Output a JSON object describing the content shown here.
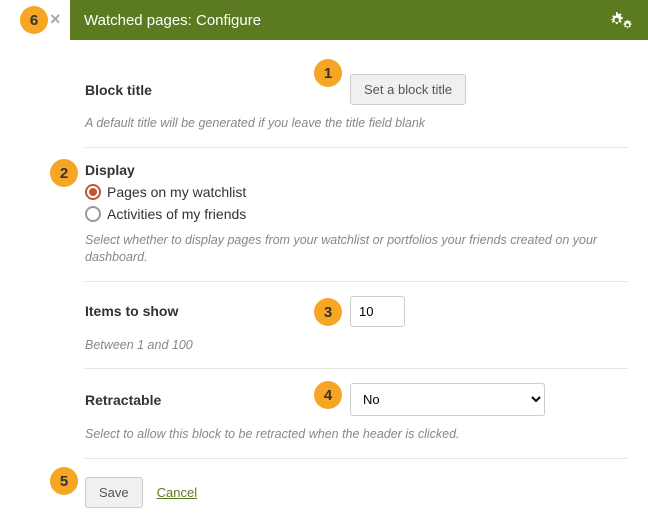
{
  "header": {
    "title": "Watched pages: Configure"
  },
  "blockTitle": {
    "label": "Block title",
    "button": "Set a block title",
    "help": "A default title will be generated if you leave the title field blank"
  },
  "display": {
    "label": "Display",
    "options": [
      {
        "label": "Pages on my watchlist",
        "checked": true
      },
      {
        "label": "Activities of my friends",
        "checked": false
      }
    ],
    "help": "Select whether to display pages from your watchlist or portfolios your friends created on your dashboard."
  },
  "itemsToShow": {
    "label": "Items to show",
    "value": "10",
    "help": "Between 1 and 100"
  },
  "retractable": {
    "label": "Retractable",
    "value": "No",
    "help": "Select to allow this block to be retracted when the header is clicked."
  },
  "actions": {
    "save": "Save",
    "cancel": "Cancel"
  },
  "badges": {
    "b1": "1",
    "b2": "2",
    "b3": "3",
    "b4": "4",
    "b5": "5",
    "b6": "6"
  }
}
